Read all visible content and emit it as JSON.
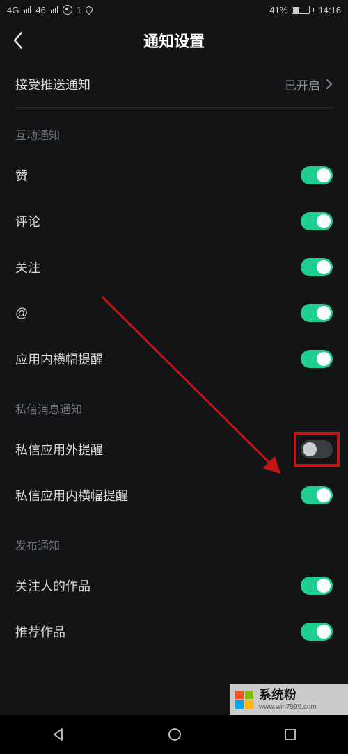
{
  "status": {
    "signal1_label": "4G",
    "signal2_label": "46",
    "eye_count": "1",
    "battery_pct": "41%",
    "time": "14:16"
  },
  "header": {
    "title": "通知设置"
  },
  "rows": {
    "push": {
      "label": "接受推送通知",
      "value": "已开启"
    }
  },
  "sections": {
    "interactive": {
      "title": "互动通知",
      "items": {
        "like": {
          "label": "赞",
          "on": true
        },
        "comment": {
          "label": "评论",
          "on": true
        },
        "follow": {
          "label": "关注",
          "on": true
        },
        "at": {
          "label": "@",
          "on": true
        },
        "banner": {
          "label": "应用内横幅提醒",
          "on": true
        }
      }
    },
    "dm": {
      "title": "私信消息通知",
      "items": {
        "dm_ext": {
          "label": "私信应用外提醒",
          "on": false,
          "highlight": true
        },
        "dm_banner": {
          "label": "私信应用内横幅提醒",
          "on": true
        }
      }
    },
    "publish": {
      "title": "发布通知",
      "items": {
        "followee_work": {
          "label": "关注人的作品",
          "on": true
        },
        "recommend": {
          "label": "推荐作品",
          "on": true
        }
      }
    }
  },
  "watermark": {
    "brand": "系统粉",
    "url": "www.win7999.com"
  },
  "colors": {
    "accent": "#1fcf8f",
    "highlight": "#c41414"
  }
}
